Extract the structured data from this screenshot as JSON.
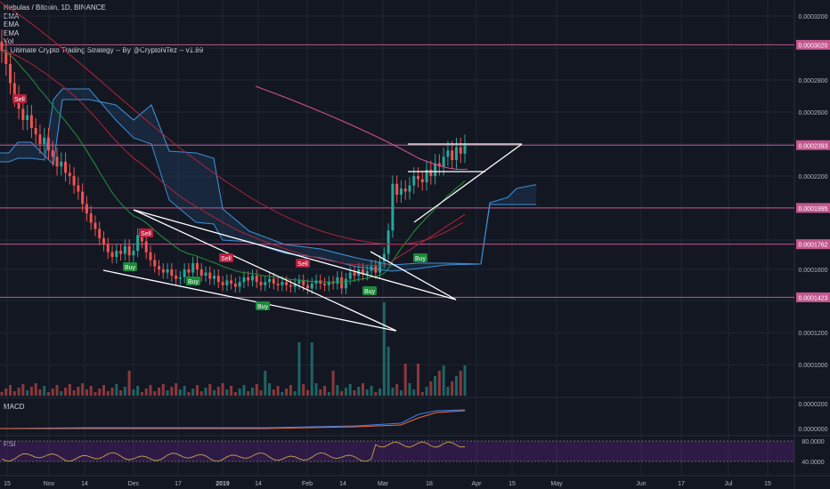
{
  "legend": {
    "symbol": "Nebulas / Bitcoin, 1D, BINANCE",
    "indicators": [
      "EMA",
      "EMA",
      "EMA",
      "Vol",
      "-- Ultimate Crypto Trading Strategy -- By @CryptoNTez -- v1.89"
    ]
  },
  "panels": {
    "macd_label": "MACD",
    "rsi_label": "RSI"
  },
  "colors": {
    "background": "#131722",
    "grid": "#1e2433",
    "up": "#26a69a",
    "down": "#ef5350",
    "ema_short": "#2a8f3b",
    "ema_mid": "#b0243c",
    "ema_long": "#d6548a",
    "cloud": "#3b8fd6",
    "hline": "#c2578d",
    "trendline": "#ffffff",
    "rsi": "#c9a24b",
    "macd": "#3c7ff0",
    "signal": "#ef6c3a"
  },
  "chart_data": {
    "type": "candlestick",
    "title": "Nebulas / Bitcoin, 1D, BINANCE",
    "x_ticks": [
      "15",
      "Nov",
      "14",
      "Dec",
      "17",
      "2019",
      "14",
      "Feb",
      "14",
      "Mar",
      "18",
      "Apr",
      "15",
      "May",
      "Jun",
      "17",
      "Jul",
      "15"
    ],
    "y_ticks": [
      "0.0003200",
      "0.0002800",
      "0.0002600",
      "0.0002200",
      "0.0001600",
      "0.0001200",
      "0.0001000"
    ],
    "price_levels": [
      "0.0003020",
      "0.0002393",
      "0.0001995",
      "0.0001762",
      "0.0001423"
    ],
    "ylim": [
      9e-05,
      0.00033
    ],
    "signals": [
      {
        "label": "Sell",
        "type": "sell"
      },
      {
        "label": "Buy",
        "type": "buy"
      },
      {
        "label": "Sell",
        "type": "sell"
      },
      {
        "label": "Buy",
        "type": "buy"
      },
      {
        "label": "Sell",
        "type": "sell"
      },
      {
        "label": "Buy",
        "type": "buy"
      },
      {
        "label": "Sell",
        "type": "sell"
      },
      {
        "label": "Buy",
        "type": "buy"
      },
      {
        "label": "Buy",
        "type": "buy"
      }
    ],
    "macd_ticks": [
      "0.0000200",
      "0.0000000"
    ],
    "rsi_ticks": [
      "80.0000",
      "40.0000"
    ],
    "close_series": [
      0.000298,
      0.00029,
      0.000278,
      0.00027,
      0.000262,
      0.000255,
      0.000258,
      0.00025,
      0.000246,
      0.00024,
      0.000244,
      0.000236,
      0.000232,
      0.000226,
      0.000229,
      0.000222,
      0.00022,
      0.000214,
      0.00021,
      0.000202,
      0.000196,
      0.00019,
      0.000186,
      0.00018,
      0.000176,
      0.000171,
      0.000168,
      0.000172,
      0.00017,
      0.000175,
      0.000169,
      0.000172,
      0.000182,
      0.000178,
      0.000171,
      0.000166,
      0.000162,
      0.00016,
      0.000158,
      0.00016,
      0.000156,
      0.000154,
      0.000155,
      0.00016,
      0.000158,
      0.000164,
      0.00016,
      0.000156,
      0.000158,
      0.000154,
      0.000156,
      0.000152,
      0.00015,
      0.000153,
      0.000151,
      0.000149,
      0.000152,
      0.000155,
      0.000153,
      0.000156,
      0.000152,
      0.00015,
      0.000152,
      0.000154,
      0.000151,
      0.00015,
      0.000152,
      0.00015,
      0.000149,
      0.000151,
      0.000153,
      0.00015,
      0.000148,
      0.000151,
      0.000153,
      0.000151,
      0.00015,
      0.000152,
      0.000151,
      0.000155,
      0.000148,
      0.000154,
      0.000158,
      0.000156,
      0.00016,
      0.000157,
      0.000159,
      0.000162,
      0.000158,
      0.000165,
      0.00017,
      0.000185,
      0.000215,
      0.000208,
      0.000212,
      0.00021,
      0.000214,
      0.00022,
      0.000218,
      0.000216,
      0.000224,
      0.00022,
      0.000228,
      0.000226,
      0.000232,
      0.000236,
      0.00023,
      0.000238,
      0.000234,
      0.00024
    ]
  }
}
